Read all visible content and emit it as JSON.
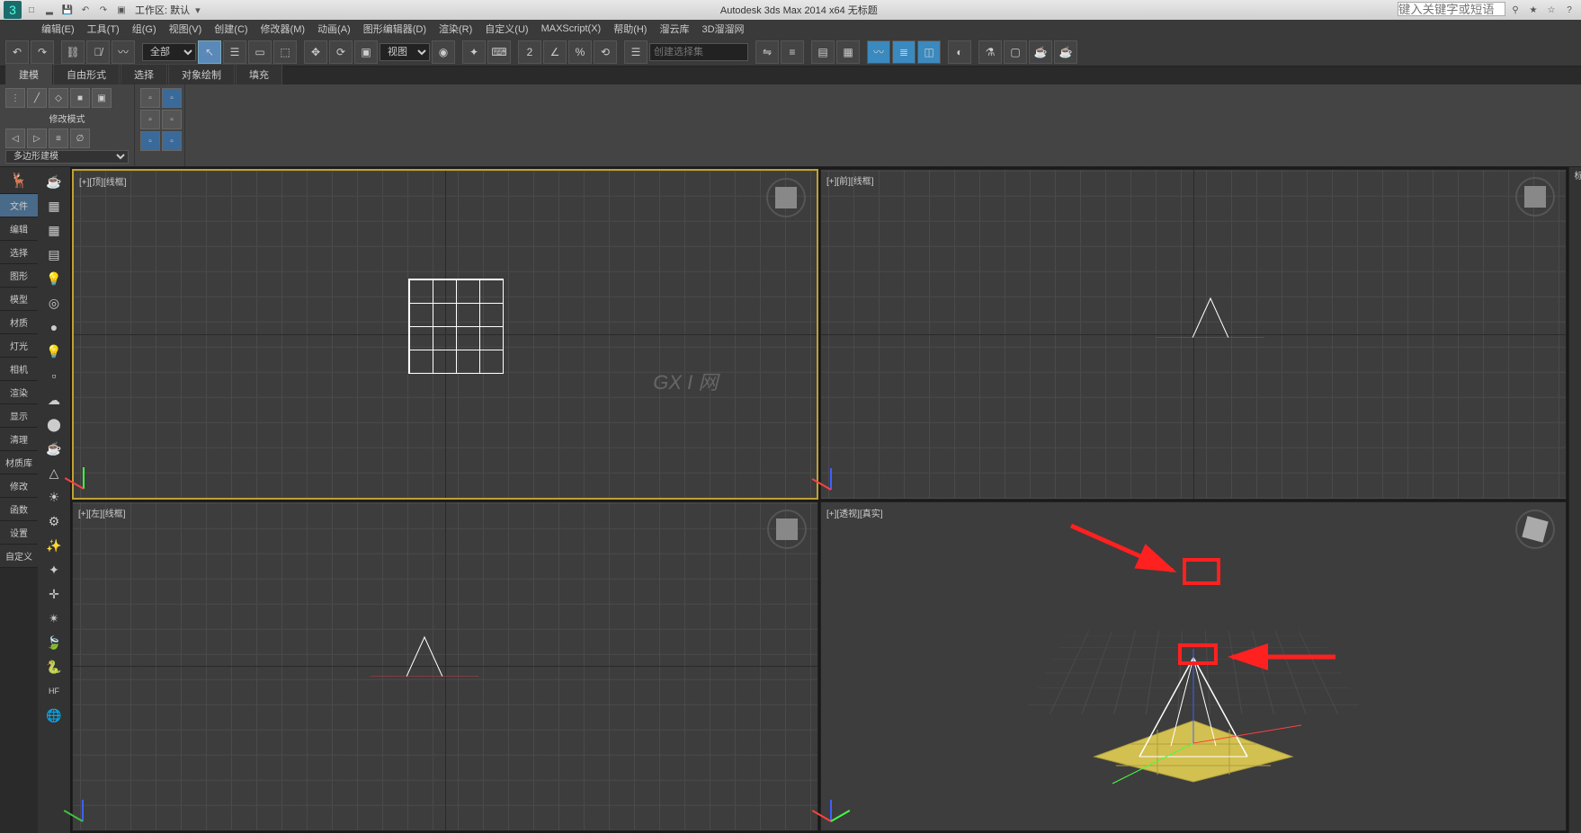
{
  "app": {
    "title_center": "Autodesk 3ds Max  2014 x64     无标题",
    "workspace_label": "工作区: 默认",
    "help_placeholder": "键入关键字或短语"
  },
  "menus": [
    "编辑(E)",
    "工具(T)",
    "组(G)",
    "视图(V)",
    "创建(C)",
    "修改器(M)",
    "动画(A)",
    "图形编辑器(D)",
    "渲染(R)",
    "自定义(U)",
    "MAXScript(X)",
    "帮助(H)",
    "溜云库",
    "3D溜溜网"
  ],
  "toolbar": {
    "filter_combo": "全部",
    "view_combo": "视图",
    "named_set_placeholder": "创建选择集"
  },
  "ribbon": {
    "tabs": [
      "建模",
      "自由形式",
      "选择",
      "对象绘制",
      "填充"
    ],
    "active_tab": "建模",
    "group1_label": "修改模式",
    "polygon_combo": "多边形建模"
  },
  "left_tabs": [
    "文件",
    "编辑",
    "选择",
    "图形",
    "模型",
    "材质",
    "灯光",
    "相机",
    "渲染",
    "显示",
    "清理",
    "材质库",
    "修改",
    "函数",
    "设置",
    "自定义"
  ],
  "viewports": {
    "top": {
      "label": "[+][顶][线框]"
    },
    "front": {
      "label": "[+][前][线框]"
    },
    "left": {
      "label": "[+][左][线框]"
    },
    "persp": {
      "label": "[+][透视][真实]"
    }
  },
  "watermark": "GX I 网",
  "icons": {
    "undo": "↶",
    "redo": "↷",
    "link": "⛓",
    "select": "▭",
    "move": "✥",
    "rotate": "⟳",
    "scale": "▣",
    "snap": "⌖",
    "angle": "∠",
    "mirror": "⇋",
    "align": "≡",
    "layers": "▤",
    "curve": "〰",
    "render": "☕",
    "teapot": "☕",
    "deer": "🦌",
    "grid": "▦",
    "light": "💡",
    "sphere": "●",
    "tri": "△",
    "sun": "☀",
    "gear": "⚙",
    "wand": "✨",
    "star": "✴",
    "leaf": "🍃",
    "snake": "🐍",
    "globe": "🌐",
    "axis": "✛",
    "hf": "HF"
  },
  "chart_data": {
    "type": "other",
    "note": "This image is a 3ds Max UI screenshot; no quantitative chart data present."
  }
}
